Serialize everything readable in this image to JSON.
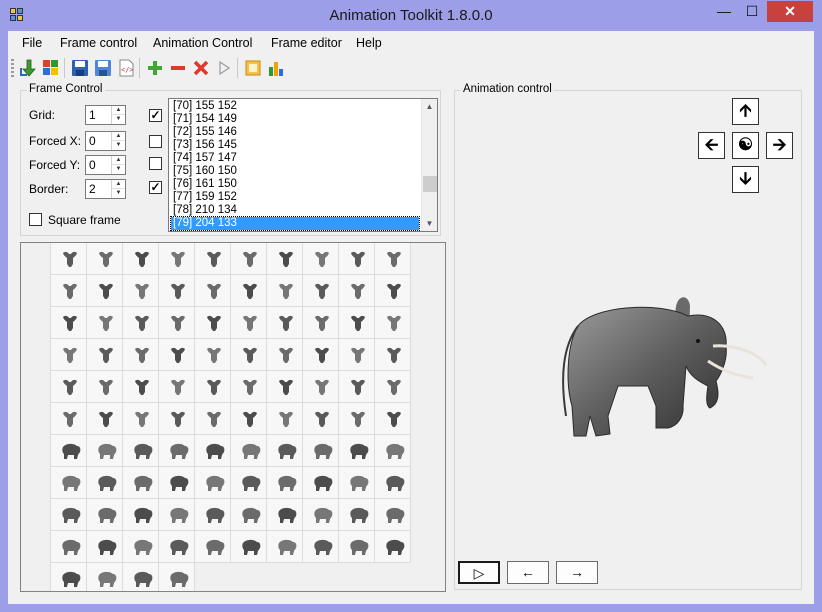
{
  "window": {
    "title": "Animation Toolkit 1.8.0.0",
    "minimize": "—",
    "maximize": "☐",
    "close": "✕"
  },
  "menu": [
    "File",
    "Frame control",
    "Animation Control",
    "Frame editor",
    "Help"
  ],
  "toolbar": {
    "icons": [
      "import-icon",
      "palette-icon",
      "save-icon",
      "save-as-icon",
      "export-code-icon",
      "add-icon",
      "remove-icon",
      "delete-icon",
      "play-icon",
      "frame-icon",
      "chart-icon"
    ]
  },
  "frame_control": {
    "title": "Frame Control",
    "fields": [
      {
        "label": "Grid:",
        "value": "1",
        "checked": true
      },
      {
        "label": "Forced X:",
        "value": "0",
        "checked": false
      },
      {
        "label": "Forced Y:",
        "value": "0",
        "checked": false
      },
      {
        "label": "Border:",
        "value": "2",
        "checked": true
      }
    ],
    "square_frame_label": "Square frame",
    "square_frame_checked": false,
    "frames": [
      "[70] 155 152",
      "[71] 154 149",
      "[72] 155 146",
      "[73] 156 145",
      "[74] 157 147",
      "[75] 160 150",
      "[76] 161 150",
      "[77] 159 152",
      "[78] 210 134",
      "[79] 204 133"
    ],
    "selected_frame": "[79] 204 133"
  },
  "animation_control": {
    "title": "Animation control",
    "up": "🡩",
    "left": "🡨",
    "center": "☯",
    "right": "🡪",
    "down": "🡫",
    "play": "▷",
    "prev": "←",
    "next": "→"
  },
  "colors": {
    "title_bar": "#9c9ee8",
    "close_button": "#c7423d",
    "selection": "#3399ff",
    "panel": "#f0f0f0"
  }
}
